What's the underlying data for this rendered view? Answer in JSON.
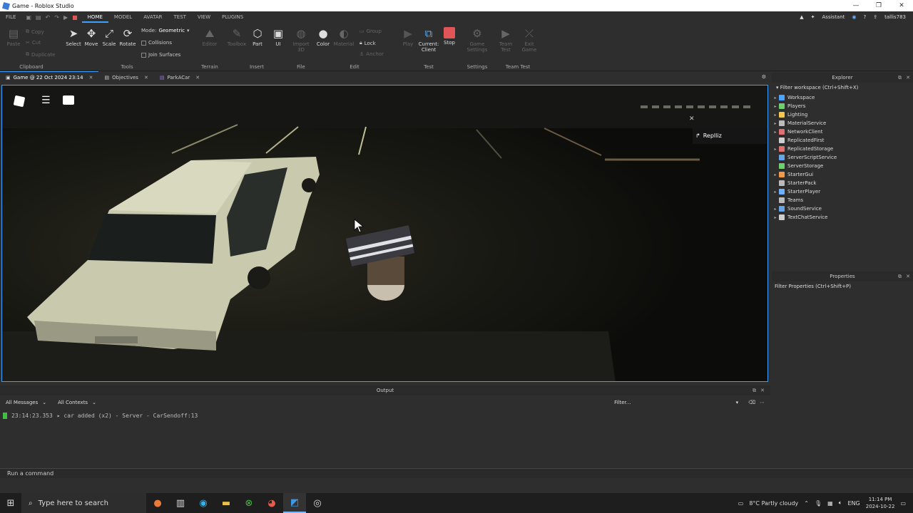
{
  "window": {
    "title": "Game - Roblox Studio",
    "controls": [
      "—",
      "❐",
      "✕"
    ]
  },
  "menubar": {
    "file": "FILE",
    "tabs": [
      "HOME",
      "MODEL",
      "AVATAR",
      "TEST",
      "VIEW",
      "PLUGINS"
    ],
    "assistant": "Assistant",
    "user": "tallis783"
  },
  "ribbon": {
    "clipboard": {
      "label": "Clipboard",
      "paste": "Paste",
      "copy": "Copy",
      "cut": "Cut",
      "duplicate": "Duplicate"
    },
    "tools": {
      "label": "Tools",
      "select": "Select",
      "move": "Move",
      "scale": "Scale",
      "rotate": "Rotate",
      "mode_label": "Mode:",
      "mode_value": "Geometric",
      "collisions": "Collisions",
      "join_surfaces": "Join Surfaces"
    },
    "terrain": {
      "label": "Terrain",
      "editor": "Editor"
    },
    "insert": {
      "label": "Insert",
      "toolbox": "Toolbox",
      "part": "Part",
      "ui": "UI"
    },
    "file": {
      "label": "File",
      "import": "Import 3D"
    },
    "edit": {
      "label": "Edit",
      "color": "Color",
      "material": "Material",
      "group": "Group",
      "lock": "Lock",
      "anchor": "Anchor"
    },
    "test": {
      "label": "Test",
      "play": "Play",
      "current": "Current:",
      "client": "Client",
      "stop": "Stop"
    },
    "settings": {
      "label": "Settings",
      "game_settings": "Game Settings"
    },
    "team_test": {
      "label": "Team Test",
      "team_test": "Team Test",
      "exit_game": "Exit Game"
    }
  },
  "doc_tabs": [
    {
      "label": "Game @ 22 Oct 2024 23:14"
    },
    {
      "label": "Objectives"
    },
    {
      "label": "ParkACar"
    }
  ],
  "viewport": {
    "notification": "Replliz",
    "close": "✕"
  },
  "output": {
    "title": "Output",
    "filter1": "All Messages",
    "filter2": "All Contexts",
    "filter_placeholder": "Filter...",
    "log": [
      {
        "time": "23:14:23.353",
        "message": "▸ car added (x2)  -  Server - CarSendoff:13"
      }
    ]
  },
  "command_bar": {
    "placeholder": "Run a command"
  },
  "explorer": {
    "title": "Explorer",
    "filter": "Filter workspace (Ctrl+Shift+X)",
    "items": [
      {
        "label": "Workspace",
        "color": "#4aa3ff",
        "expandable": true
      },
      {
        "label": "Players",
        "color": "#6fcf6f",
        "expandable": true
      },
      {
        "label": "Lighting",
        "color": "#f2c94c",
        "expandable": true
      },
      {
        "label": "MaterialService",
        "color": "#bbbbbb",
        "expandable": true
      },
      {
        "label": "NetworkClient",
        "color": "#e07070",
        "expandable": true
      },
      {
        "label": "ReplicatedFirst",
        "color": "#cfcfcf",
        "expandable": false
      },
      {
        "label": "ReplicatedStorage",
        "color": "#e07070",
        "expandable": true
      },
      {
        "label": "ServerScriptService",
        "color": "#66a6e8",
        "expandable": false
      },
      {
        "label": "ServerStorage",
        "color": "#6fcf6f",
        "expandable": false
      },
      {
        "label": "StarterGui",
        "color": "#f2994a",
        "expandable": true
      },
      {
        "label": "StarterPack",
        "color": "#bbbbbb",
        "expandable": false
      },
      {
        "label": "StarterPlayer",
        "color": "#6fb1ff",
        "expandable": true
      },
      {
        "label": "Teams",
        "color": "#bbbbbb",
        "expandable": false
      },
      {
        "label": "SoundService",
        "color": "#66a6e8",
        "expandable": true
      },
      {
        "label": "TextChatService",
        "color": "#cfcfcf",
        "expandable": true
      }
    ]
  },
  "properties": {
    "title": "Properties",
    "filter": "Filter Properties (Ctrl+Shift+P)"
  },
  "taskbar": {
    "search": "Type here to search",
    "weather": "8°C  Partly cloudy",
    "lang": "ENG",
    "time": "11:14 PM",
    "date": "2024-10-22"
  },
  "colors": {
    "accent": "#3ca0ff",
    "stop": "#e05555",
    "play": "#555555"
  }
}
